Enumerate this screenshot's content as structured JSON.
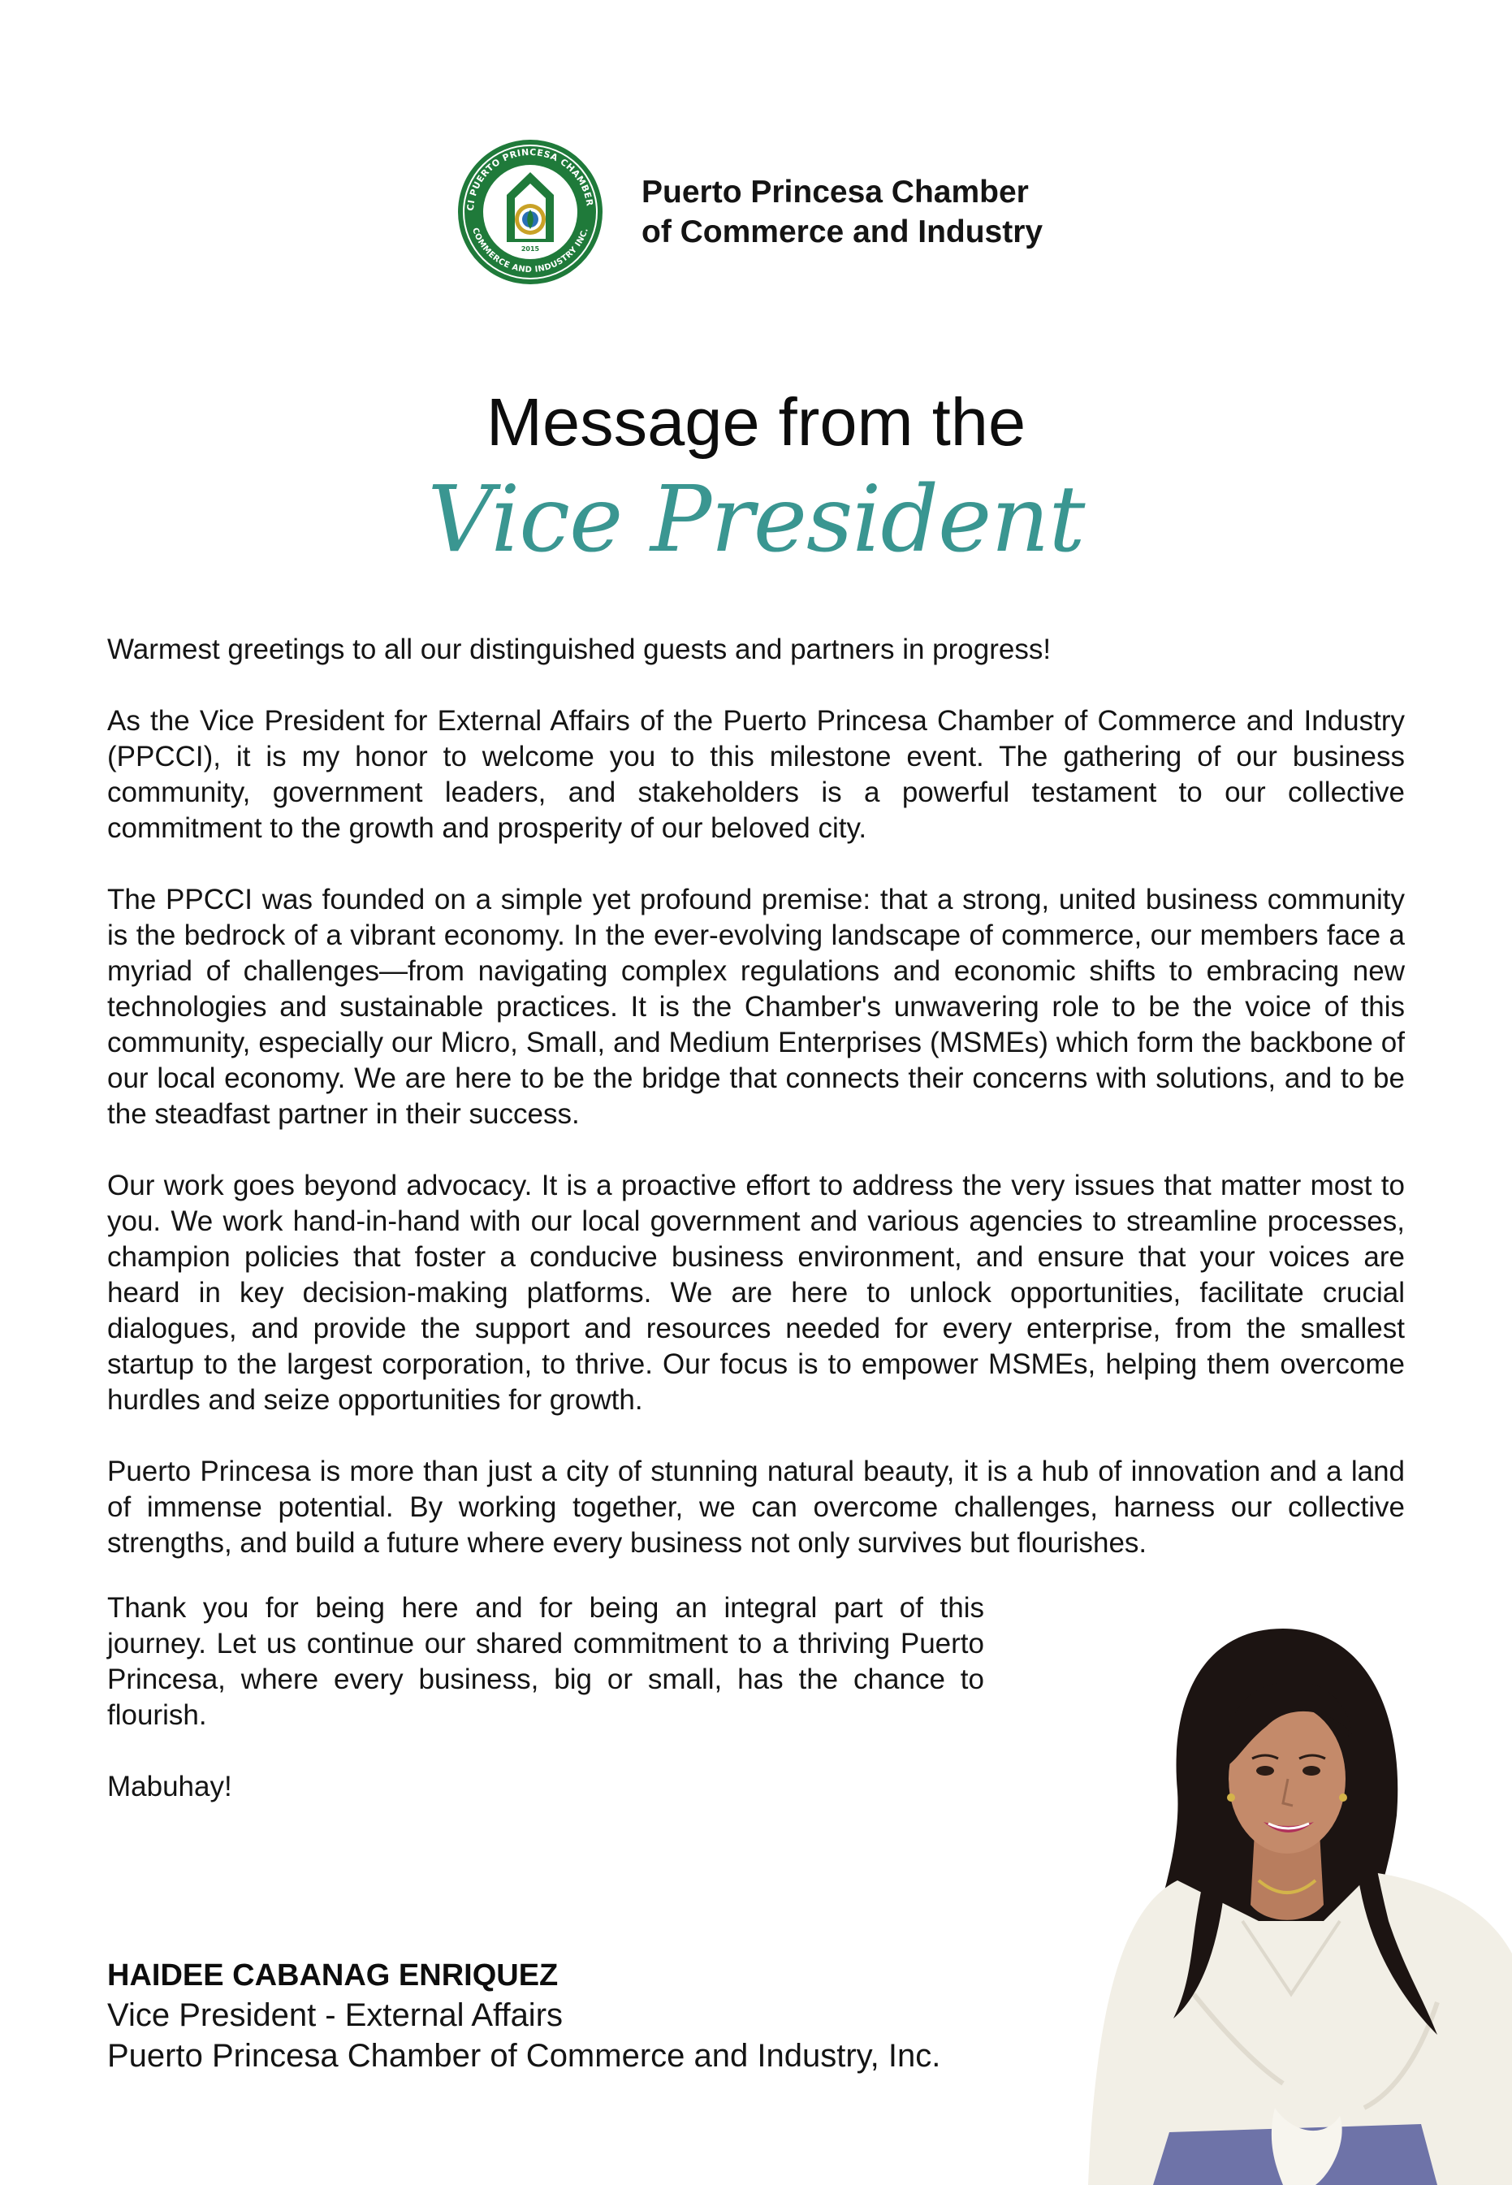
{
  "header": {
    "org_name_line1": "Puerto Princesa Chamber",
    "org_name_line2": "of Commerce and Industry",
    "logo": {
      "icon": "ppcci-seal-logo",
      "ring_text_top": "PCCI PUERTO PRINCESA CHAMBER OF",
      "ring_text_bottom": "COMMERCE AND INDUSTRY INC.",
      "year": "2015",
      "colors": {
        "green": "#1f7a3a",
        "gold": "#c9a227",
        "blue": "#2a6fb5"
      }
    }
  },
  "title": {
    "line1": "Message from the",
    "line2": "Vice President",
    "accent_color": "#3a9691"
  },
  "body": {
    "greeting": "Warmest greetings to all our distinguished guests and partners in progress!",
    "paragraph1": "As the Vice President for External Affairs of the Puerto Princesa Chamber of Commerce and Industry (PPCCI), it is my honor to welcome you to this milestone event. The gathering of our business community, government leaders, and stakeholders is a powerful testament to our collective commitment to the growth and prosperity of our beloved city.",
    "paragraph2": "The PPCCI was founded on a simple yet profound premise: that a strong, united business community is the bedrock of a vibrant economy. In the ever-evolving landscape of commerce, our members face a myriad of challenges—from navigating complex regulations and economic shifts to embracing new technologies and sustainable practices. It is the Chamber's unwavering role to be the voice of this community, especially our Micro, Small, and Medium Enterprises (MSMEs) which form the backbone of our local economy. We are here to be the bridge that connects their concerns with solutions, and to be the steadfast partner in their success.",
    "paragraph3": "Our work goes beyond advocacy. It is a proactive effort to address the very issues that matter most to you. We work hand-in-hand with our local government and various agencies to streamline processes, champion policies that foster a conducive business environment, and ensure that your voices are heard in key decision-making platforms. We are here to unlock opportunities, facilitate crucial dialogues, and provide the support and resources needed for every enterprise, from the smallest startup to the largest corporation, to thrive. Our focus is to empower MSMEs, helping them overcome hurdles and seize opportunities for growth.",
    "paragraph4": "Puerto Princesa is more than just a city of stunning natural beauty, it is a hub of innovation and a land of immense potential. By working together, we can overcome challenges, harness our collective strengths, and build a future where every business not only survives but flourishes.",
    "paragraph5": "Thank you for being here and for being an integral part of this journey. Let us continue our shared commitment to a thriving Puerto Princesa, where every business, big or small, has the chance to flourish.",
    "closing": "Mabuhay!"
  },
  "signature": {
    "name": "HAIDEE CABANAG ENRIQUEZ",
    "role": "Vice President - External Affairs",
    "organization": "Puerto Princesa Chamber of Commerce and Industry, Inc."
  },
  "portrait": {
    "icon": "vice-president-portrait",
    "colors": {
      "hair": "#1c1412",
      "skin": "#c48a6a",
      "blouse": "#f2efe6",
      "skirt": "#6e73a8",
      "lips": "#b0305a"
    }
  }
}
